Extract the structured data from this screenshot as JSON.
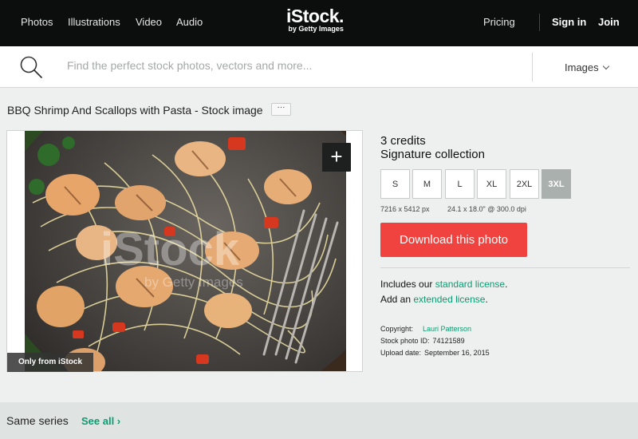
{
  "nav": {
    "links": [
      "Photos",
      "Illustrations",
      "Video",
      "Audio"
    ],
    "logo_main": "iStock.",
    "logo_sub": "by Getty Images",
    "pricing": "Pricing",
    "sign_in": "Sign in",
    "join": "Join"
  },
  "search": {
    "placeholder": "Find the perfect stock photos, vectors and more...",
    "type": "Images"
  },
  "asset": {
    "title": "BBQ Shrimp And Scallops with Pasta - Stock image",
    "more": "···",
    "add_icon": "+",
    "badge": "Only from iStock",
    "watermark_main": "iStock",
    "watermark_sub": "by Getty Images"
  },
  "purchase": {
    "credits": "3 credits",
    "collection": "Signature collection",
    "sizes": [
      "S",
      "M",
      "L",
      "XL",
      "2XL",
      "3XL"
    ],
    "selected_size": "3XL",
    "dim_px": "7216 x 5412 px",
    "dim_in": "24.1 x 18.0\" @ 300.0 dpi",
    "download": "Download this photo",
    "license_line1_prefix": "Includes our ",
    "license_line1_link": "standard license",
    "license_line1_suffix": ".",
    "license_line2_prefix": "Add an ",
    "license_line2_link": "extended license",
    "license_line2_suffix": "."
  },
  "details": {
    "copyright_label": "Copyright:",
    "copyright_value": "Lauri Patterson",
    "id_label": "Stock photo ID:",
    "id_value": "74121589",
    "date_label": "Upload date:",
    "date_value": "September 16, 2015"
  },
  "series": {
    "label": "Same series",
    "see_all": "See all ›"
  },
  "colors": {
    "accent_green": "#0b9c71",
    "download_red": "#f0423f",
    "nav_bg": "#0c0d0d"
  }
}
